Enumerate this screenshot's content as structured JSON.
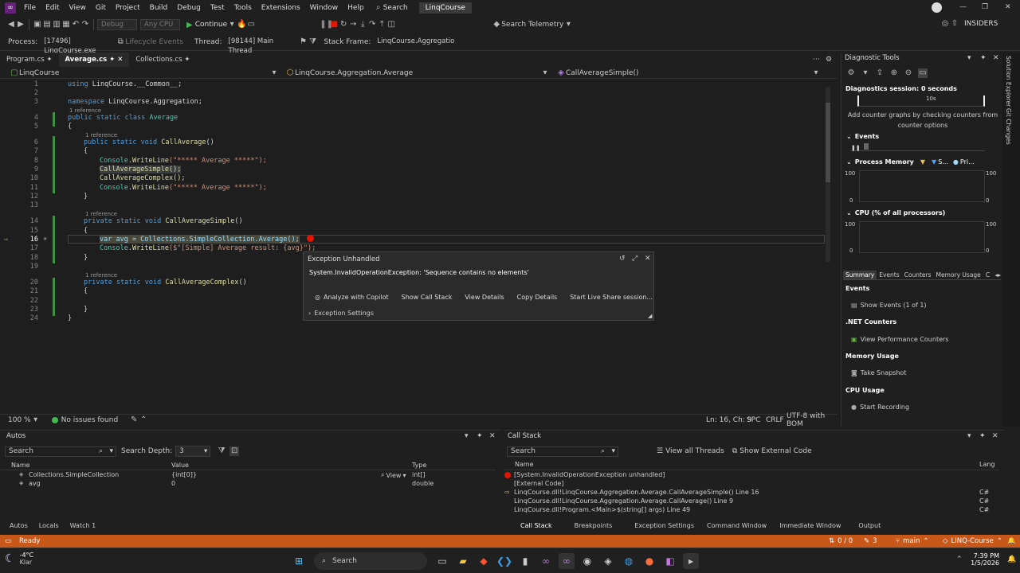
{
  "menu": [
    "File",
    "Edit",
    "View",
    "Git",
    "Project",
    "Build",
    "Debug",
    "Test",
    "Tools",
    "Extensions",
    "Window",
    "Help"
  ],
  "search_label": "Search",
  "solution_name": "LinqCourse",
  "window_controls": [
    "—",
    "❐",
    "✕"
  ],
  "toolbar": {
    "config": "Debug",
    "platform": "Any CPU",
    "continue": "Continue",
    "search_telemetry": "Search Telemetry",
    "insiders": "INSIDERS"
  },
  "debugbar": {
    "process_label": "Process:",
    "process": "[17496] LinqCourse.exe",
    "lifecycle": "Lifecycle Events",
    "thread_label": "Thread:",
    "thread": "[98144] Main Thread",
    "stackframe_label": "Stack Frame:",
    "stackframe": "LinqCourse.Aggregatio"
  },
  "tabs": [
    {
      "label": "Program.cs"
    },
    {
      "label": "Average.cs"
    },
    {
      "label": "Collections.cs"
    }
  ],
  "nav": {
    "project": "LinqCourse",
    "class": "LinqCourse.Aggregation.Average",
    "member": "CallAverageSimple()"
  },
  "code": {
    "l1_kw": "using",
    "l1_rest": " LinqCourse.__Common__;",
    "l3_kw": "namespace",
    "l3_rest": " LinqCourse.Aggregation;",
    "ref": "1 reference",
    "l4_kw": "public static class",
    "l4_ty": " Average",
    "brace_open": "{",
    "brace_close": "}",
    "l6_kw": "public static void",
    "l6_me": " CallAverage",
    "l6_rest": "()",
    "l8_ty": "Console",
    "l8_me": ".WriteLine",
    "l8_st": "(\"***** Average *****\");",
    "l9": "CallAverageSimple();",
    "l10": "CallAverageComplex();",
    "l11_ty": "Console",
    "l11_me": ".WriteLine",
    "l11_st": "(\"***** Average *****\");",
    "l14_kw": "private static void",
    "l14_me": " CallAverageSimple",
    "l14_rest": "()",
    "l16": "var avg = Collections.SimpleCollection.Average();",
    "l17_ty": "Console",
    "l17_me": ".WriteLine",
    "l17_st": "($\"[Simple] Average result: {avg}\");",
    "l20_kw": "private static void",
    "l20_me": " CallAverageComplex",
    "l20_rest": "()"
  },
  "line_numbers": [
    "1",
    "2",
    "3",
    "4",
    "5",
    "6",
    "7",
    "8",
    "9",
    "10",
    "11",
    "12",
    "13",
    "14",
    "15",
    "16",
    "17",
    "18",
    "19",
    "20",
    "21",
    "22",
    "23",
    "24"
  ],
  "exception": {
    "title": "Exception Unhandled",
    "message": "System.InvalidOperationException: 'Sequence contains no elements'",
    "analyze": "Analyze with Copilot",
    "call_stack": "Show Call Stack",
    "details": "View Details",
    "copy": "Copy Details",
    "live_share": "Start Live Share session...",
    "settings": "Exception Settings"
  },
  "status_line": {
    "zoom": "100 %",
    "issues": "No issues found",
    "position": "Ln: 16, Ch: 9",
    "spc": "SPC",
    "crlf": "CRLF",
    "encoding": "UTF-8 with BOM"
  },
  "diag": {
    "title": "Diagnostic Tools",
    "session": "Diagnostics session: 0 seconds",
    "timeline": "10s",
    "hint": "Add counter graphs by checking counters from counter options",
    "events": "Events",
    "process_memory": "Process Memory",
    "pm_legend1": "S...",
    "pm_legend2": "Pri...",
    "cpu": "CPU (% of all processors)",
    "axis_100": "100",
    "axis_0": "0",
    "tabs": [
      "Summary",
      "Events",
      "Counters",
      "Memory Usage",
      "C"
    ],
    "sum_events": "Events",
    "show_events": "Show Events (1 of 1)",
    "net_counters": ".NET Counters",
    "view_perf": "View Performance Counters",
    "mem_usage": "Memory Usage",
    "take_snapshot": "Take Snapshot",
    "cpu_usage": "CPU Usage",
    "start_recording": "Start Recording"
  },
  "vtabs": [
    "Solution Explorer",
    "Git Changes"
  ],
  "autos": {
    "title": "Autos",
    "search": "Search",
    "depth_label": "Search Depth:",
    "depth": "3",
    "cols": [
      "Name",
      "Value",
      "Type"
    ],
    "rows": [
      {
        "name": "Collections.SimpleCollection",
        "value": "{int[0]}",
        "view": "View",
        "type": "int[]"
      },
      {
        "name": "avg",
        "value": "0",
        "type": "double"
      }
    ]
  },
  "callstack": {
    "title": "Call Stack",
    "search": "Search",
    "view_all": "View all Threads",
    "show_external": "Show External Code",
    "cols": [
      "Name",
      "Lang"
    ],
    "rows": [
      {
        "name": "[System.InvalidOperationException unhandled]",
        "lang": ""
      },
      {
        "name": "[External Code]",
        "lang": ""
      },
      {
        "name": "LinqCourse.dll!LinqCourse.Aggregation.Average.CallAverageSimple() Line 16",
        "lang": "C#"
      },
      {
        "name": "LinqCourse.dll!LinqCourse.Aggregation.Average.CallAverage() Line 9",
        "lang": "C#"
      },
      {
        "name": "LinqCourse.dll!Program.<Main>$(string[] args) Line 49",
        "lang": "C#"
      }
    ]
  },
  "bottom_tabs_left": [
    "Autos",
    "Locals",
    "Watch 1"
  ],
  "bottom_tabs_right": [
    "Call Stack",
    "Breakpoints",
    "Exception Settings",
    "Command Window",
    "Immediate Window",
    "Output"
  ],
  "statusbar": {
    "ready": "Ready",
    "updown": "0 / 0",
    "commits": "3",
    "branch": "main",
    "repo": "LINQ-Course"
  },
  "taskbar": {
    "temp": "-4°C",
    "weather": "Klar",
    "search": "Search",
    "time": "7:39 PM",
    "date": "1/5/2026"
  },
  "colors": {
    "accent": "#c8571a",
    "exception_red": "#e51400",
    "vs_purple": "#68217a"
  }
}
